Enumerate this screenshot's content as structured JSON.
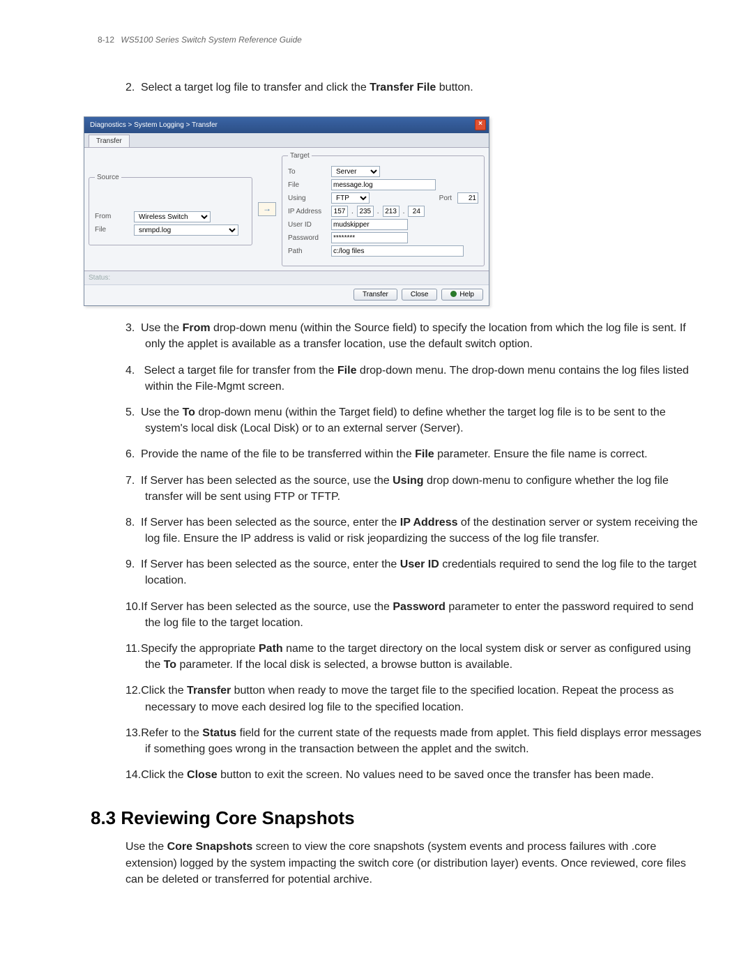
{
  "header": {
    "page_number": "8-12",
    "doc_title": "WS5100 Series Switch System Reference Guide"
  },
  "steps_a": {
    "s2": {
      "num": "2.",
      "pre": "Select a target log file to transfer and click the ",
      "bold": "Transfer File",
      "post": " button."
    }
  },
  "shot": {
    "title": "Diagnostics > System Logging > Transfer",
    "tab": "Transfer",
    "source_legend": "Source",
    "from_label": "From",
    "from_value": "Wireless Switch",
    "file_label": "File",
    "file_value": "snmpd.log",
    "target_legend": "Target",
    "to_label": "To",
    "to_value": "Server",
    "tfile_label": "File",
    "tfile_value": "message.log",
    "using_label": "Using",
    "using_value": "FTP",
    "port_label": "Port",
    "port_value": "21",
    "ip_label": "IP Address",
    "ip": [
      "157",
      "235",
      "213",
      "24"
    ],
    "uid_label": "User ID",
    "uid_value": "mudskipper",
    "pw_label": "Password",
    "pw_value": "********",
    "path_label": "Path",
    "path_value": "c:/log files",
    "status_label": "Status:",
    "btn_transfer": "Transfer",
    "btn_close": "Close",
    "btn_help": "Help"
  },
  "steps_b": {
    "s3": {
      "num": "3.",
      "t1": "Use the ",
      "b1": "From",
      "t2": " drop-down menu (within the Source field) to specify the location from which the log file is sent. If only the applet is available as a transfer location, use the default switch option."
    },
    "s4": {
      "num": "4.",
      "t1": " Select a target file for transfer from the ",
      "b1": "File",
      "t2": " drop-down menu. The drop-down menu contains the log files listed within the File-Mgmt screen."
    },
    "s5": {
      "num": "5.",
      "t1": "Use the ",
      "b1": "To",
      "t2": " drop-down menu (within the Target field) to define whether the target log file is to be sent to the system's local disk (Local Disk) or to an external server (Server)."
    },
    "s6": {
      "num": "6.",
      "t1": "Provide the name of the file to be transferred within the ",
      "b1": "File",
      "t2": " parameter. Ensure the file name is correct."
    },
    "s7": {
      "num": "7.",
      "t1": "If Server has been selected as the source, use the ",
      "b1": "Using",
      "t2": " drop down-menu to configure whether the log file transfer will be sent using FTP or TFTP."
    },
    "s8": {
      "num": "8.",
      "t1": "If Server has been selected as the source, enter the ",
      "b1": "IP Address",
      "t2": " of the destination server or system receiving the log file. Ensure the IP address is valid or risk jeopardizing the success of the log file transfer."
    },
    "s9": {
      "num": "9.",
      "t1": "If Server has been selected as the source, enter the ",
      "b1": "User ID",
      "t2": " credentials required to send the log file to the target location."
    },
    "s10": {
      "num": "10.",
      "t1": "If Server has been selected as the source, use the ",
      "b1": "Password",
      "t2": " parameter to enter the password required to send the log file to the target location."
    },
    "s11": {
      "num": "11.",
      "t1": "Specify the appropriate ",
      "b1": "Path",
      "t2": " name to the target directory on the local system disk or server as configured using the ",
      "b2": "To",
      "t3": " parameter. If the local disk is selected, a browse button is available."
    },
    "s12": {
      "num": "12.",
      "t1": "Click the ",
      "b1": "Transfer",
      "t2": " button when ready to move the target file to the specified location. Repeat the process as necessary to move each desired log file to the specified location."
    },
    "s13": {
      "num": "13.",
      "t1": "Refer to the ",
      "b1": "Status",
      "t2": " field for the current state of the requests made from applet. This field displays error messages if something goes wrong in the transaction between the applet and the switch."
    },
    "s14": {
      "num": "14.",
      "t1": "Click the ",
      "b1": "Close",
      "t2": " button to exit the screen. No values need to be saved once the transfer has been made."
    }
  },
  "section": {
    "num": "8.3",
    "title": "Reviewing Core Snapshots",
    "para_pre": "Use the ",
    "para_bold": "Core Snapshots",
    "para_post": " screen to view the core snapshots (system events and process failures with .core extension) logged by the system impacting the switch core (or distribution layer) events. Once reviewed, core files can be deleted or transferred for potential archive."
  }
}
